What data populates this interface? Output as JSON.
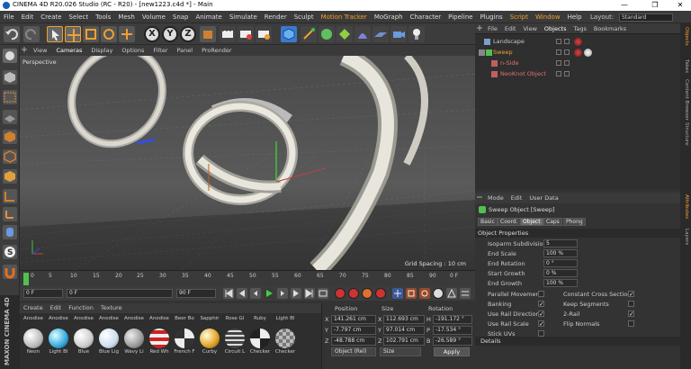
{
  "window": {
    "title": "CINEMA 4D R20.026 Studio (RC - R20) - [new1223.c4d *] - Main",
    "controls": [
      "—",
      "❐",
      "✕"
    ]
  },
  "menu": {
    "items": [
      "File",
      "Edit",
      "Create",
      "Select",
      "Tools",
      "Mesh",
      "Volume",
      "Snap",
      "Animate",
      "Simulate",
      "Render",
      "Sculpt",
      "Motion Tracker",
      "MoGraph",
      "Character",
      "Pipeline",
      "Plugins",
      "Script",
      "Window",
      "Help"
    ],
    "layout_label": "Layout:",
    "layout_value": "Standard"
  },
  "toolbar": {
    "axis_x": "X",
    "axis_y": "Y",
    "axis_z": "Z"
  },
  "viewport": {
    "menu": [
      "View",
      "Cameras",
      "Display",
      "Options",
      "Filter",
      "Panel",
      "ProRender"
    ],
    "label": "Perspective",
    "grid_spacing": "Grid Spacing : 10 cm"
  },
  "timeline": {
    "ticks": [
      "0",
      "5",
      "10",
      "15",
      "20",
      "25",
      "30",
      "35",
      "40",
      "45",
      "50",
      "55",
      "60",
      "65",
      "70",
      "75",
      "80",
      "85",
      "90"
    ],
    "end_label": "0 F"
  },
  "playback": {
    "start": "0 F",
    "current": "0 F",
    "end": "90 F",
    "max": "90 F"
  },
  "materials": {
    "menu": [
      "Create",
      "Edit",
      "Function",
      "Texture"
    ],
    "row1": [
      "Anodise",
      "Anodise",
      "Anodise",
      "Anodise",
      "Anodise",
      "Anodise",
      "Beer Bo",
      "Sapphir",
      "Rose Gl",
      "Ruby",
      "Light Bl"
    ],
    "row2": [
      "Neon",
      "Light Bl",
      "Blue",
      "Blue Lig",
      "Wavy Li",
      "Red Wh",
      "French F",
      "Curby",
      "Circuit L",
      "Checker",
      "Checker"
    ],
    "colors": [
      "#e8e8e8",
      "#5fe0f0",
      "#e8e8e8",
      "#c8d8e8",
      "#b0b0b8",
      "#c03030",
      "#d0d0d0",
      "#e0a020",
      "#c0c0c0",
      "#f0f0f0",
      "#a0a0a0"
    ],
    "brand_1": "MAXON",
    "brand_2": "CINEMA 4D"
  },
  "coordinates": {
    "headers": [
      "Position",
      "Size",
      "Rotation"
    ],
    "rows": [
      {
        "axis": "X",
        "pos": "141.261 cm",
        "size": "112.693 cm",
        "rot_label": "H",
        "rot": "-191.172 °"
      },
      {
        "axis": "Y",
        "pos": "-7.797 cm",
        "size": "97.014 cm",
        "rot_label": "P",
        "rot": "-17.534 °"
      },
      {
        "axis": "Z",
        "pos": "-48.788 cm",
        "size": "102.791 cm",
        "rot_label": "B",
        "rot": "-26.589 °"
      }
    ],
    "mode": "Object (Rel)",
    "size_mode": "Size",
    "apply": "Apply"
  },
  "object_manager": {
    "menu": [
      "File",
      "Edit",
      "View",
      "Objects",
      "Tags",
      "Bookmarks"
    ],
    "objects": [
      {
        "name": "Landscape",
        "color": "#c8c8c8",
        "indent": 0
      },
      {
        "name": "Sweep",
        "color": "#f0a030",
        "indent": 0
      },
      {
        "name": "n-Side",
        "color": "#e07070",
        "indent": 1
      },
      {
        "name": "NeoKnot Object",
        "color": "#e07070",
        "indent": 1
      }
    ]
  },
  "attributes": {
    "menu": [
      "Mode",
      "Edit",
      "User Data"
    ],
    "object_title": "Sweep Object [Sweep]",
    "tabs": [
      "Basic",
      "Coord.",
      "Object",
      "Caps",
      "Phong"
    ],
    "active_tab": "Object",
    "section": "Object Properties",
    "fields": [
      {
        "label": "Isoparm Subdivision",
        "value": "5"
      },
      {
        "label": "End Scale",
        "value": "100 %"
      },
      {
        "label": "End Rotation",
        "value": "0 °"
      },
      {
        "label": "Start Growth",
        "value": "0 %"
      },
      {
        "label": "End Growth",
        "value": "100 %"
      }
    ],
    "checks_left": [
      {
        "label": "Parallel Movement",
        "checked": false
      },
      {
        "label": "Banking",
        "checked": true
      },
      {
        "label": "Use Rail Direction",
        "checked": true
      },
      {
        "label": "Use Rail Scale",
        "checked": true
      },
      {
        "label": "Stick UVs",
        "checked": false
      }
    ],
    "checks_right": [
      {
        "label": "Constant Cross Section",
        "checked": true
      },
      {
        "label": "Keep Segments",
        "checked": false
      },
      {
        "label": "2-Rail",
        "checked": true
      },
      {
        "label": "Flip Normals",
        "checked": false
      }
    ],
    "details": "Details",
    "check_mark": "✓"
  },
  "right_tabs": [
    "Objects",
    "Takes",
    "Content Browser",
    "Structure",
    "Attributes",
    "Layers"
  ]
}
